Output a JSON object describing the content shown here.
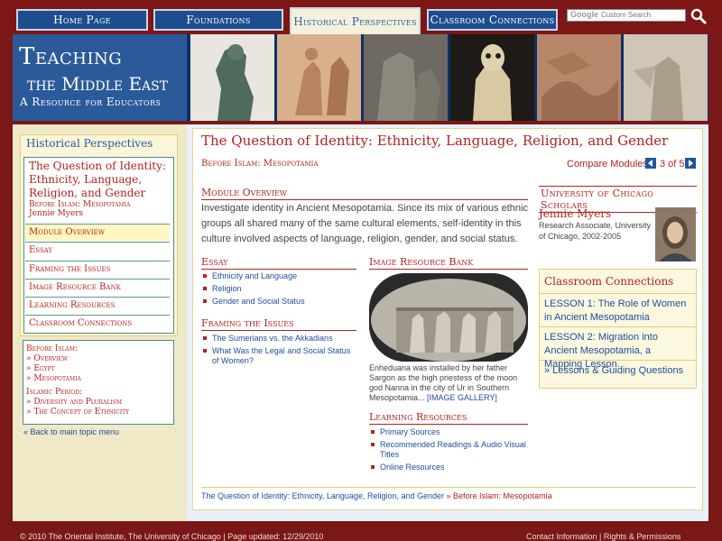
{
  "nav": {
    "tabs": [
      "Home Page",
      "Foundations",
      "Historical Perspectives",
      "Classroom Connections"
    ],
    "search_brand": "Google",
    "search_placeholder": "Custom Search"
  },
  "banner": {
    "title_line1": "Teaching",
    "title_line2": "the Middle East",
    "title_line3": "A Resource for Educators"
  },
  "sidebar": {
    "header": "Historical Perspectives",
    "current_title": "The Question of Identity: Ethnicity, Language, Religion, and Gender",
    "current_sub": "Before Islam:  Mesopotamia",
    "current_author": "Jennie Myers",
    "items": [
      "Module Overview",
      "Essay",
      "Framing the Issues",
      "Image Resource Bank",
      "Learning Resources",
      "Classroom Connections"
    ],
    "before_label": "Before Islam:",
    "before_links": [
      "» Overview",
      "» Egypt",
      "» Mesopotamia"
    ],
    "islamic_label": "Islamic Period:",
    "islamic_links": [
      "» Diversity and Pluralism",
      "» The Concept of Ethnicity"
    ],
    "back_link": "« Back to main topic menu"
  },
  "main": {
    "title": "The Question of Identity: Ethnicity, Language, Religion, and Gender",
    "subtitle": "Before Islam:  Mesopotamia",
    "compare_label": "Compare Modules",
    "compare_page": "3 of 5",
    "overview_heading": "Module Overview",
    "overview_text": "Investigate identity in Ancient Mesopotamia. Since its mix of various ethnic groups all shared many of the same cultural elements, self-identity in this culture involved aspects of language, religion, gender, and social status.",
    "essay_heading": "Essay",
    "essay_links": [
      "Ethnicity and Language",
      "Religion",
      "Gender and Social Status"
    ],
    "framing_heading": "Framing the Issues",
    "framing_links": [
      "The Sumerians vs. the Akkadians",
      "What Was the Legal and Social Status of Women?"
    ],
    "image_heading": "Image Resource Bank",
    "image_caption": "Enheduana was installed by her father Sargon as the high priestess of the moon god Nanna in the city of Ur in Southern Mesopotamia...",
    "image_gallery_link": "[IMAGE GALLERY]",
    "learning_heading": "Learning Resources",
    "learning_links": [
      "Primary Sources",
      "Recommended Readings & Audio Visual Titles",
      "Online Resources"
    ],
    "scholars_heading": "University of Chicago Scholars",
    "scholar_name": "Jennie Myers",
    "scholar_role": "Research Associate, University of Chicago, 2002-2005",
    "classroom_heading": "Classroom Connections",
    "classroom_links": [
      "LESSON 1: The Role of Women in Ancient Mesopotamia",
      "LESSON 2: Migration into Ancient Mesopotamia, a Mapping Lesson.",
      "» Lessons & Guiding Questions"
    ],
    "bottom_crumb_link": "The Question of Identity: Ethnicity, Language, Religion, and Gender",
    "bottom_crumb_current": "» Before Islam: Mesopotamia"
  },
  "footer": {
    "left": "© 2010 The Oriental Institute, The University of Chicago  |  Page updated: 12/29/2010",
    "right": "Contact Information  |  Rights & Permissions"
  }
}
